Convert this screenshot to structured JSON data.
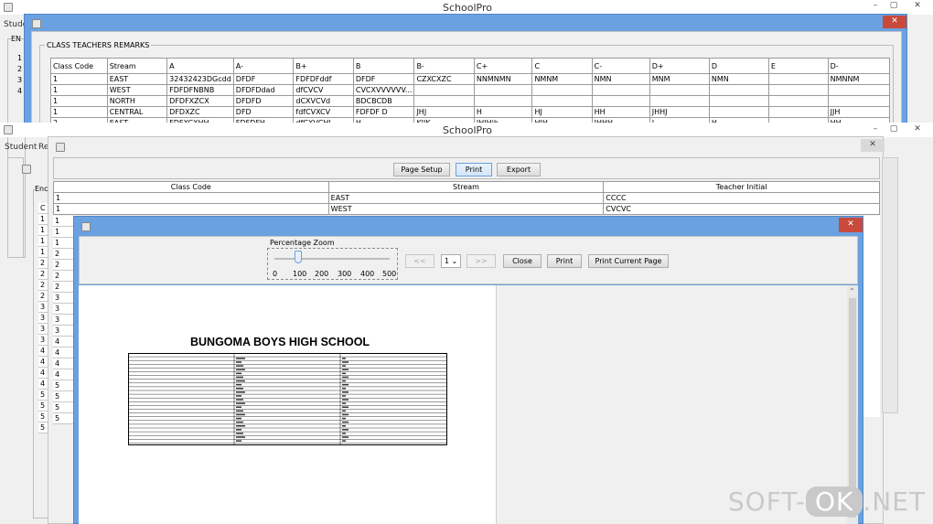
{
  "bg_window": {
    "title": "SchoolPro",
    "menu": [
      "Stude"
    ],
    "group_label": "EN",
    "row_numbers": [
      "1",
      "2",
      "3",
      "4"
    ]
  },
  "remarks_window": {
    "group_title": "CLASS TEACHERS REMARKS",
    "columns": [
      "Class Code",
      "Stream",
      "A",
      "A-",
      "B+",
      "B",
      "B-",
      "C+",
      "C",
      "C-",
      "D+",
      "D",
      "E",
      "D-"
    ],
    "rows": [
      [
        "1",
        "EAST",
        "32432423DGcdd",
        "DFDF",
        "FDFDFddf",
        "DFDF",
        "CZXCXZC",
        "NNMNMN",
        "NMNM",
        "NMN",
        "MNM",
        "NMN",
        "",
        "NMNNM"
      ],
      [
        "1",
        "WEST",
        "FDFDFNBNB",
        "DFDFDdad",
        "dfCVCV",
        "CVCXVVVVVV...",
        "",
        "",
        "",
        "",
        "",
        "",
        "",
        ""
      ],
      [
        "1",
        "NORTH",
        "DFDFXZCX",
        "DFDFD",
        "dCXVCVd",
        "BDCBCDB",
        "",
        "",
        "",
        "",
        "",
        "",
        "",
        ""
      ],
      [
        "1",
        "CENTRAL",
        "DFDXZC",
        "DFD",
        "fdfCVXCV",
        "FDFDF D",
        "JHJ",
        "H",
        "HJ",
        "HH",
        "JHHJ",
        "",
        "",
        "JJH"
      ],
      [
        "2",
        "EAST",
        "FDFXCXHH",
        "FDFDFH",
        "dfCXVCHJ",
        "H",
        "KJJK",
        "JHJHjh",
        "HJH",
        "JHHH",
        "J",
        "H",
        "",
        "HH"
      ]
    ]
  },
  "second_window": {
    "title": "SchoolPro",
    "menu": [
      "Student",
      "Re"
    ],
    "group_label": "Enc",
    "buttons": {
      "page_setup": "Page Setup",
      "print": "Print",
      "export": "Export"
    },
    "columns": [
      "Class Code",
      "Stream",
      "Teacher Initial"
    ],
    "rows": [
      [
        "1",
        "EAST",
        "CCCC"
      ],
      [
        "1",
        "WEST",
        "CVCVC"
      ]
    ],
    "left_codes": [
      "1",
      "1",
      "1",
      "2",
      "2",
      "2",
      "2",
      "3",
      "3",
      "3",
      "3",
      "4",
      "4",
      "4",
      "4",
      "5",
      "5",
      "5",
      "5"
    ],
    "far_left_codes": [
      "C",
      "1",
      "1",
      "1",
      "1",
      "2",
      "2",
      "2",
      "2",
      "3",
      "3",
      "3",
      "3",
      "4",
      "4",
      "4",
      "4",
      "5",
      "5",
      "5",
      "5"
    ]
  },
  "preview_window": {
    "zoom_label": "Percentage Zoom",
    "zoom_ticks": [
      "0",
      "100",
      "200",
      "300",
      "400",
      "500"
    ],
    "zoom_value": 100,
    "nav": {
      "prev": "<<",
      "page": "1",
      "next": ">>"
    },
    "buttons": {
      "close": "Close",
      "print": "Print",
      "print_current": "Print Current Page"
    },
    "doc_title": "BUNGOMA BOYS HIGH SCHOOL"
  },
  "watermark": {
    "left": "SOFT-",
    "ok": "OK",
    "right": ".NET"
  }
}
